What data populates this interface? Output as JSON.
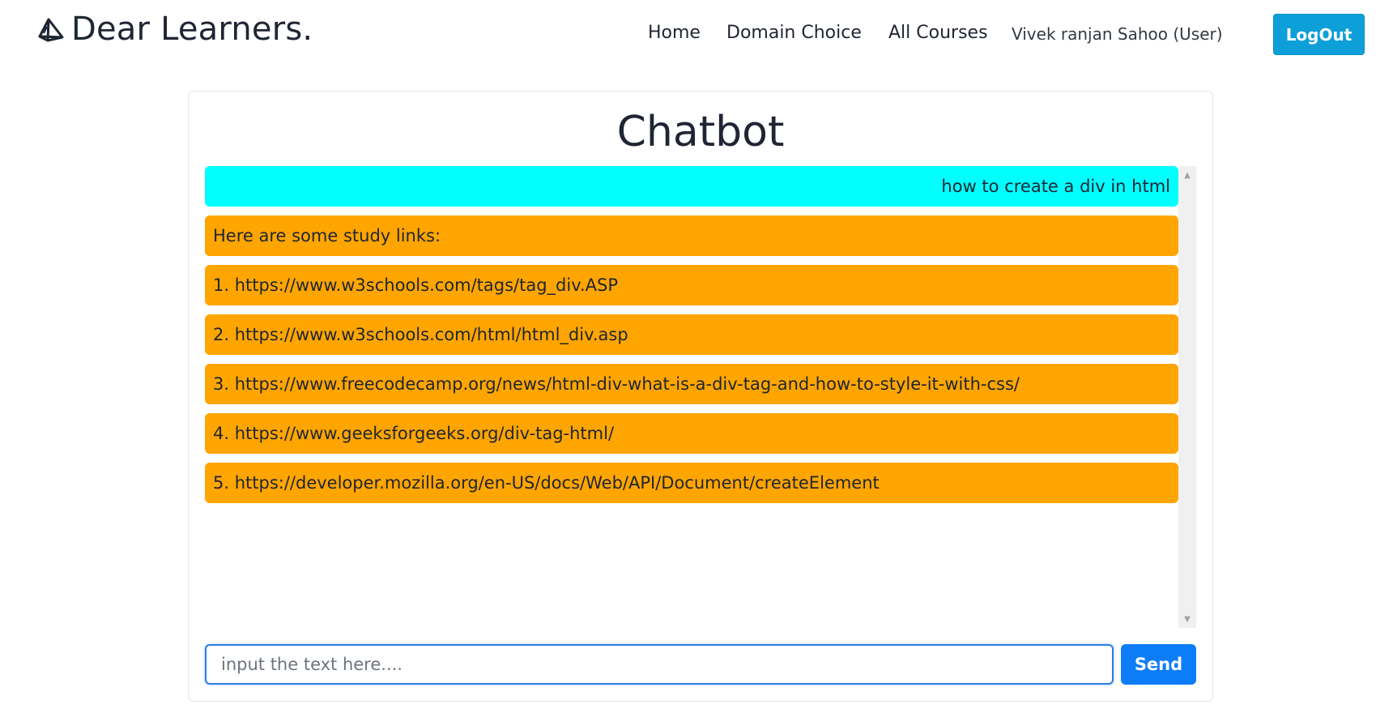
{
  "header": {
    "brand": "Dear Learners.",
    "brand_icon": "book-icon",
    "nav": {
      "home": "Home",
      "domain_choice": "Domain Choice",
      "all_courses": "All Courses",
      "user": "Vivek ranjan Sahoo (User)"
    },
    "logout_label": "LogOut"
  },
  "chat": {
    "title": "Chatbot",
    "messages": [
      {
        "role": "user",
        "text": "how to create a div in html"
      },
      {
        "role": "bot",
        "text": "Here are some study links:"
      },
      {
        "role": "bot",
        "text": "1. https://www.w3schools.com/tags/tag_div.ASP"
      },
      {
        "role": "bot",
        "text": "2. https://www.w3schools.com/html/html_div.asp"
      },
      {
        "role": "bot",
        "text": "3. https://www.freecodecamp.org/news/html-div-what-is-a-div-tag-and-how-to-style-it-with-css/"
      },
      {
        "role": "bot",
        "text": "4. https://www.geeksforgeeks.org/div-tag-html/"
      },
      {
        "role": "bot",
        "text": "5. https://developer.mozilla.org/en-US/docs/Web/API/Document/createElement"
      }
    ],
    "input": {
      "placeholder": "input the text here....",
      "value": ""
    },
    "send_label": "Send"
  },
  "colors": {
    "user_bubble": "#00ffff",
    "bot_bubble": "#ffa500",
    "logout_button": "#0d9fd8",
    "send_button": "#0d7df7",
    "input_border": "#2a7de1"
  }
}
